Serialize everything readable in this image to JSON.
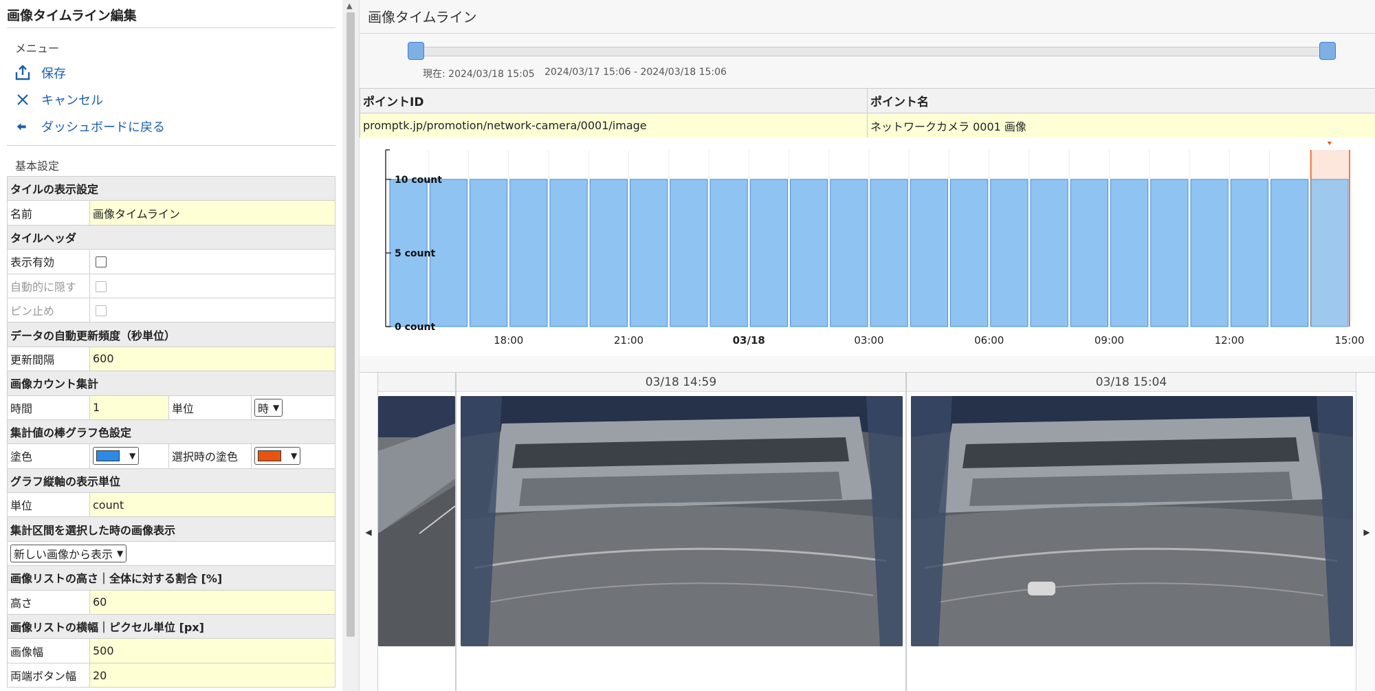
{
  "left": {
    "title": "画像タイムライン編集",
    "menu_label": "メニュー",
    "menu": [
      {
        "label": "保存",
        "icon": "upload-icon"
      },
      {
        "label": "キャンセル",
        "icon": "close-icon"
      },
      {
        "label": "ダッシュボードに戻る",
        "icon": "back-arrow-icon"
      }
    ],
    "basic_label": "基本設定",
    "settings": {
      "tile_display": "タイルの表示設定",
      "name_label": "名前",
      "name_value": "画像タイムライン",
      "tile_header": "タイルヘッダ",
      "show_enabled": "表示有効",
      "auto_hide": "自動的に隠す",
      "pin": "ピン止め",
      "refresh_header": "データの自動更新頻度（秒単位）",
      "refresh_label": "更新間隔",
      "refresh_value": "600",
      "count_header": "画像カウント集計",
      "time_label": "時間",
      "time_value": "1",
      "unit_label": "単位",
      "unit_value": "時",
      "bar_color_header": "集計値の棒グラフ色設定",
      "fill_label": "塗色",
      "fill_color": "#2b8ae6",
      "selected_fill_label": "選択時の塗色",
      "selected_fill_color": "#e8540f",
      "axis_unit_header": "グラフ縦軸の表示単位",
      "axis_unit_label": "単位",
      "axis_unit_value": "count",
      "interval_header": "集計区間を選択した時の画像表示",
      "interval_value": "新しい画像から表示",
      "list_height_header": "画像リストの高さ｜全体に対する割合 [%]",
      "height_label": "高さ",
      "height_value": "60",
      "list_width_header": "画像リストの横幅｜ピクセル単位 [px]",
      "image_width_label": "画像幅",
      "image_width_value": "500",
      "edge_btn_label": "両端ボタン幅",
      "edge_btn_value": "20"
    }
  },
  "right": {
    "title": "画像タイムライン",
    "slider_now": "現在: 2024/03/18 15:05",
    "slider_range": "2024/03/17 15:06 - 2024/03/18 15:06",
    "point_id_header": "ポイントID",
    "point_name_header": "ポイント名",
    "point_id": "promptk.jp/promotion/network-camera/0001/image",
    "point_name": "ネットワークカメラ 0001 画像",
    "images": [
      {
        "time": ""
      },
      {
        "time": "03/18 14:59"
      },
      {
        "time": "03/18 15:04"
      }
    ],
    "prev_icon": "chevron-left-icon",
    "next_icon": "chevron-right-icon"
  },
  "chart_data": {
    "type": "bar",
    "unit": "count",
    "y_tick_labels": [
      "0 count",
      "5 count",
      "10 count"
    ],
    "ylim": [
      0,
      12
    ],
    "x_tick_labels": [
      "18:00",
      "21:00",
      "03/18",
      "03:00",
      "06:00",
      "09:00",
      "12:00",
      "15:00"
    ],
    "values": [
      10,
      10,
      10,
      10,
      10,
      10,
      10,
      10,
      10,
      10,
      10,
      10,
      10,
      10,
      10,
      10,
      10,
      10,
      10,
      10,
      10,
      10,
      10,
      10
    ],
    "selected_index": 23,
    "bar_color": "#8ec3f2",
    "bar_stroke": "#4a8fd8",
    "selected_color": "#e8540f"
  }
}
